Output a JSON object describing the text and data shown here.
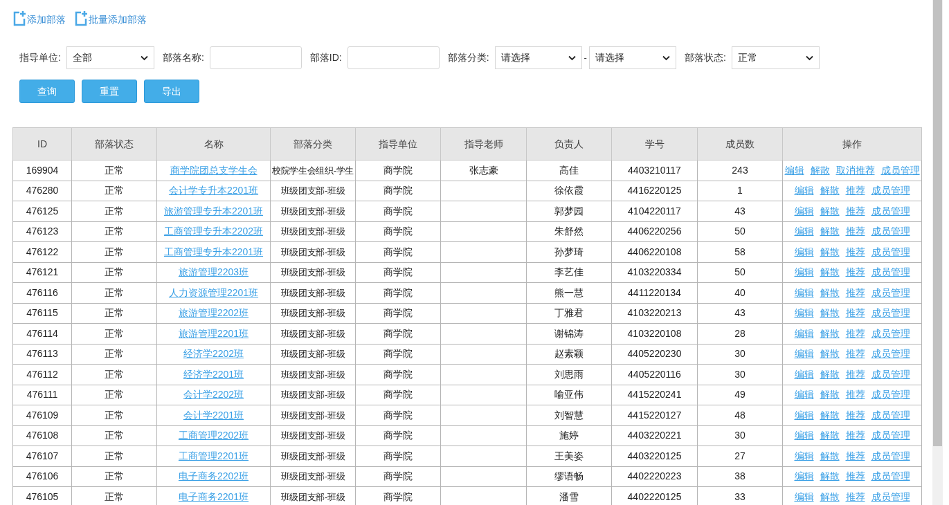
{
  "toolbar": [
    {
      "label": "添加部落"
    },
    {
      "label": "批量添加部落"
    }
  ],
  "filters": [
    {
      "kind": "select",
      "label": "指导单位:",
      "value": "全部"
    },
    {
      "kind": "input",
      "label": "部落名称:"
    },
    {
      "kind": "input",
      "label": "部落ID:"
    },
    {
      "kind": "select_pair",
      "label": "部落分类:",
      "values": [
        "请选择",
        "请选择"
      ],
      "separator": "-"
    },
    {
      "kind": "select",
      "label": "部落状态:",
      "value": "正常"
    }
  ],
  "buttons": [
    "查询",
    "重置",
    "导出"
  ],
  "table": {
    "columns": [
      "ID",
      "部落状态",
      "名称",
      "部落分类",
      "指导单位",
      "指导老师",
      "负责人",
      "学号",
      "成员数",
      "操作"
    ],
    "rows": [
      {
        "id": "169904",
        "status": "正常",
        "name": "商学院团总支学生会",
        "category": "校院学生会组织-学生",
        "unit": "商学院",
        "teacher": "张志豪",
        "leader": "高佳",
        "student_no": "4403210117",
        "members": "243",
        "actions": [
          "编辑",
          "解散",
          "取消推荐",
          "成员管理"
        ]
      },
      {
        "id": "476280",
        "status": "正常",
        "name": "会计学专升本2201班",
        "category": "班级团支部-班级",
        "unit": "商学院",
        "teacher": "",
        "leader": "徐依霞",
        "student_no": "4416220125",
        "members": "1",
        "actions": [
          "编辑",
          "解散",
          "推荐",
          "成员管理"
        ]
      },
      {
        "id": "476125",
        "status": "正常",
        "name": "旅游管理专升本2201班",
        "category": "班级团支部-班级",
        "unit": "商学院",
        "teacher": "",
        "leader": "郭梦园",
        "student_no": "4104220117",
        "members": "43",
        "actions": [
          "编辑",
          "解散",
          "推荐",
          "成员管理"
        ]
      },
      {
        "id": "476123",
        "status": "正常",
        "name": "工商管理专升本2202班",
        "category": "班级团支部-班级",
        "unit": "商学院",
        "teacher": "",
        "leader": "朱舒然",
        "student_no": "4406220256",
        "members": "50",
        "actions": [
          "编辑",
          "解散",
          "推荐",
          "成员管理"
        ]
      },
      {
        "id": "476122",
        "status": "正常",
        "name": "工商管理专升本2201班",
        "category": "班级团支部-班级",
        "unit": "商学院",
        "teacher": "",
        "leader": "孙梦琦",
        "student_no": "4406220108",
        "members": "58",
        "actions": [
          "编辑",
          "解散",
          "推荐",
          "成员管理"
        ]
      },
      {
        "id": "476121",
        "status": "正常",
        "name": "旅游管理2203班",
        "category": "班级团支部-班级",
        "unit": "商学院",
        "teacher": "",
        "leader": "李艺佳",
        "student_no": "4103220334",
        "members": "50",
        "actions": [
          "编辑",
          "解散",
          "推荐",
          "成员管理"
        ]
      },
      {
        "id": "476116",
        "status": "正常",
        "name": "人力资源管理2201班",
        "category": "班级团支部-班级",
        "unit": "商学院",
        "teacher": "",
        "leader": "熊一慧",
        "student_no": "4411220134",
        "members": "40",
        "actions": [
          "编辑",
          "解散",
          "推荐",
          "成员管理"
        ]
      },
      {
        "id": "476115",
        "status": "正常",
        "name": "旅游管理2202班",
        "category": "班级团支部-班级",
        "unit": "商学院",
        "teacher": "",
        "leader": "丁雅君",
        "student_no": "4103220213",
        "members": "43",
        "actions": [
          "编辑",
          "解散",
          "推荐",
          "成员管理"
        ]
      },
      {
        "id": "476114",
        "status": "正常",
        "name": "旅游管理2201班",
        "category": "班级团支部-班级",
        "unit": "商学院",
        "teacher": "",
        "leader": "谢锦涛",
        "student_no": "4103220108",
        "members": "28",
        "actions": [
          "编辑",
          "解散",
          "推荐",
          "成员管理"
        ]
      },
      {
        "id": "476113",
        "status": "正常",
        "name": "经济学2202班",
        "category": "班级团支部-班级",
        "unit": "商学院",
        "teacher": "",
        "leader": "赵素颖",
        "student_no": "4405220230",
        "members": "30",
        "actions": [
          "编辑",
          "解散",
          "推荐",
          "成员管理"
        ]
      },
      {
        "id": "476112",
        "status": "正常",
        "name": "经济学2201班",
        "category": "班级团支部-班级",
        "unit": "商学院",
        "teacher": "",
        "leader": "刘思雨",
        "student_no": "4405220116",
        "members": "30",
        "actions": [
          "编辑",
          "解散",
          "推荐",
          "成员管理"
        ]
      },
      {
        "id": "476111",
        "status": "正常",
        "name": "会计学2202班",
        "category": "班级团支部-班级",
        "unit": "商学院",
        "teacher": "",
        "leader": "喻亚伟",
        "student_no": "4415220241",
        "members": "49",
        "actions": [
          "编辑",
          "解散",
          "推荐",
          "成员管理"
        ]
      },
      {
        "id": "476109",
        "status": "正常",
        "name": "会计学2201班",
        "category": "班级团支部-班级",
        "unit": "商学院",
        "teacher": "",
        "leader": "刘智慧",
        "student_no": "4415220127",
        "members": "48",
        "actions": [
          "编辑",
          "解散",
          "推荐",
          "成员管理"
        ]
      },
      {
        "id": "476108",
        "status": "正常",
        "name": "工商管理2202班",
        "category": "班级团支部-班级",
        "unit": "商学院",
        "teacher": "",
        "leader": "施婷",
        "student_no": "4403220221",
        "members": "30",
        "actions": [
          "编辑",
          "解散",
          "推荐",
          "成员管理"
        ]
      },
      {
        "id": "476107",
        "status": "正常",
        "name": "工商管理2201班",
        "category": "班级团支部-班级",
        "unit": "商学院",
        "teacher": "",
        "leader": "王美姿",
        "student_no": "4403220125",
        "members": "27",
        "actions": [
          "编辑",
          "解散",
          "推荐",
          "成员管理"
        ]
      },
      {
        "id": "476106",
        "status": "正常",
        "name": "电子商务2202班",
        "category": "班级团支部-班级",
        "unit": "商学院",
        "teacher": "",
        "leader": "缪语畅",
        "student_no": "4402220223",
        "members": "38",
        "actions": [
          "编辑",
          "解散",
          "推荐",
          "成员管理"
        ]
      },
      {
        "id": "476105",
        "status": "正常",
        "name": "电子商务2201班",
        "category": "班级团支部-班级",
        "unit": "商学院",
        "teacher": "",
        "leader": "潘雪",
        "student_no": "4402220125",
        "members": "33",
        "actions": [
          "编辑",
          "解散",
          "推荐",
          "成员管理"
        ]
      }
    ]
  }
}
